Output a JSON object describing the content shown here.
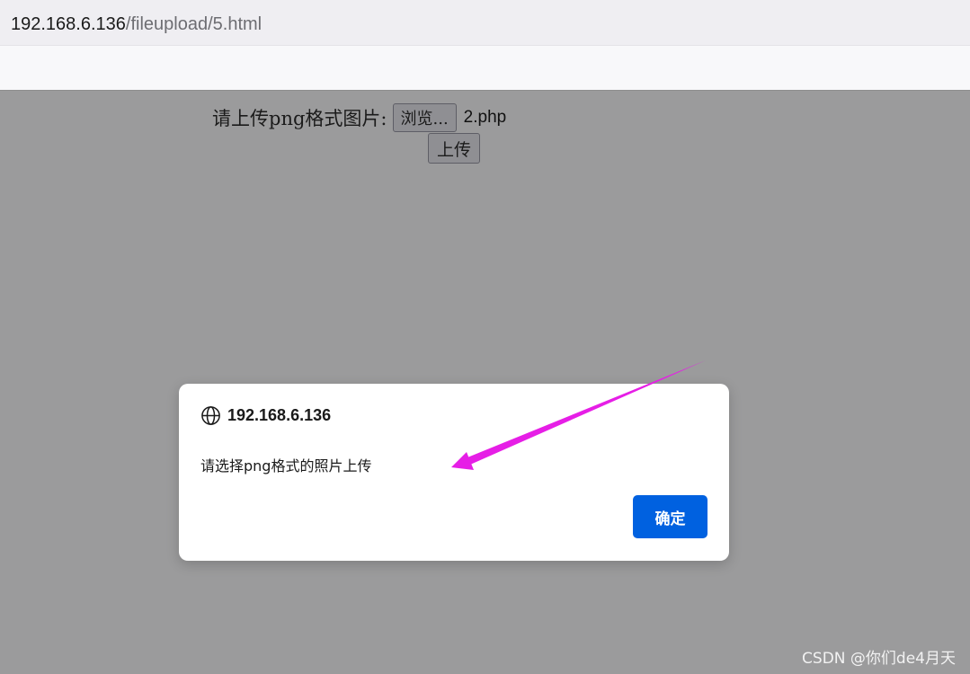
{
  "address_bar": {
    "host": "192.168.6.136",
    "path": "/fileupload/5.html"
  },
  "form": {
    "label": "请上传png格式图片:",
    "browse_label": "浏览...",
    "selected_file": "2.php",
    "submit_label": "上传"
  },
  "dialog": {
    "icon": "globe-icon",
    "origin": "192.168.6.136",
    "message": "请选择png格式的照片上传",
    "ok_label": "确定",
    "ok_color": "#0061e0"
  },
  "annotation": {
    "arrow_color": "#e61ee6"
  },
  "watermark": "CSDN @你们de4月天"
}
